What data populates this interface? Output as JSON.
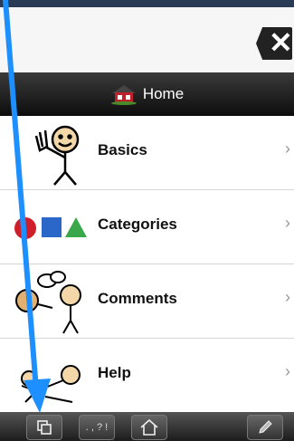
{
  "header": {
    "title": "Home",
    "close_glyph": "✕"
  },
  "menu": {
    "items": [
      {
        "label": "Basics",
        "chevron": "›"
      },
      {
        "label": "Categories",
        "chevron": "›"
      },
      {
        "label": "Comments",
        "chevron": "›"
      },
      {
        "label": "Help",
        "chevron": "›"
      }
    ]
  },
  "toolbar": {
    "punct_label": ". , ? !"
  },
  "colors": {
    "arrow": "#1e8fff",
    "title_bar": "#111111"
  }
}
